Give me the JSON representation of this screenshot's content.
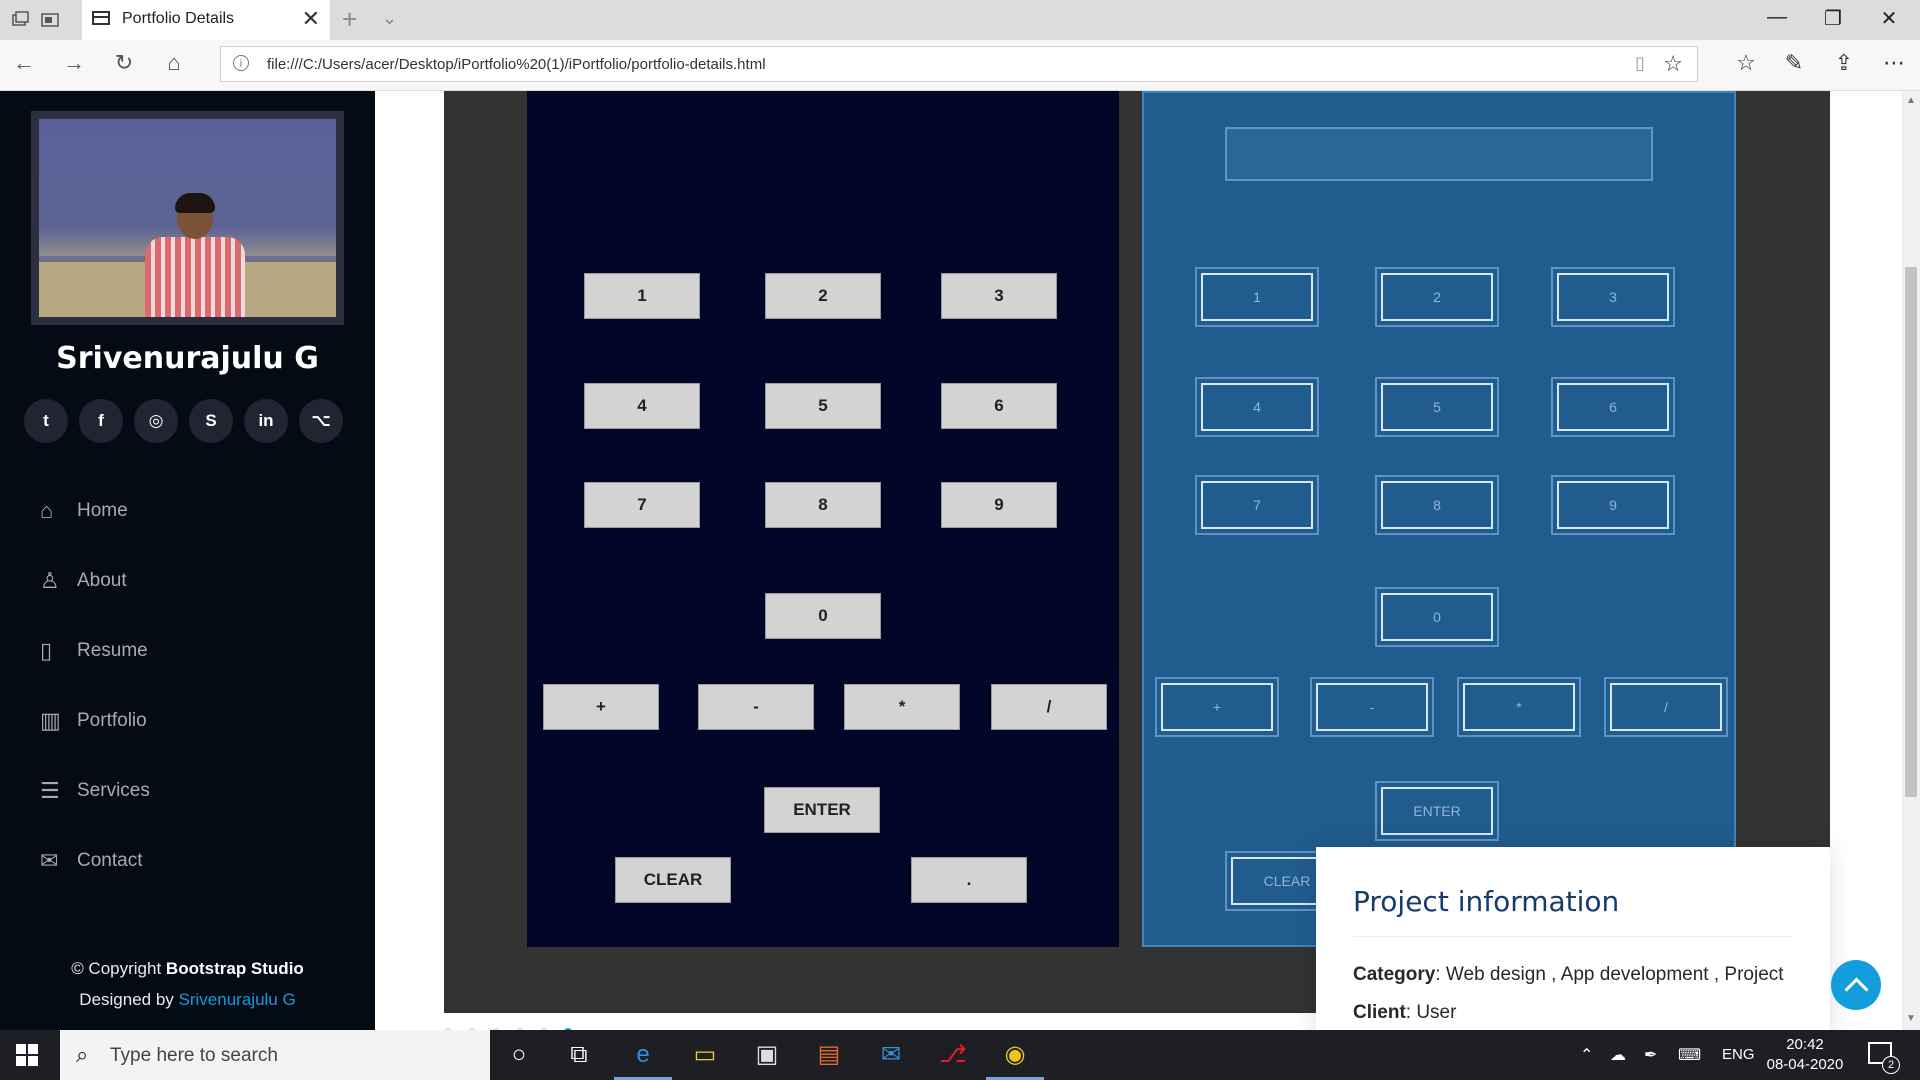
{
  "browser": {
    "tab_title": "Portfolio Details",
    "tab_close": "✕",
    "new_tab": "+",
    "url": "file:///C:/Users/acer/Desktop/iPortfolio%20(1)/iPortfolio/portfolio-details.html",
    "window_controls": [
      "—",
      "❐",
      "✕"
    ]
  },
  "sidebar": {
    "name": "Srivenurajulu G",
    "socials": [
      {
        "icon": "twitter-icon",
        "glyph": "t"
      },
      {
        "icon": "facebook-icon",
        "glyph": "f"
      },
      {
        "icon": "instagram-icon",
        "glyph": "◎"
      },
      {
        "icon": "skype-icon",
        "glyph": "S"
      },
      {
        "icon": "linkedin-icon",
        "glyph": "in"
      },
      {
        "icon": "github-icon",
        "glyph": "⌥"
      }
    ],
    "nav": [
      {
        "label": "Home",
        "icon": "home-icon",
        "glyph": "⌂"
      },
      {
        "label": "About",
        "icon": "user-icon",
        "glyph": "♙"
      },
      {
        "label": "Resume",
        "icon": "file-icon",
        "glyph": "▯"
      },
      {
        "label": "Portfolio",
        "icon": "book-icon",
        "glyph": "▥"
      },
      {
        "label": "Services",
        "icon": "server-icon",
        "glyph": "☰"
      },
      {
        "label": "Contact",
        "icon": "envelope-icon",
        "glyph": "✉"
      }
    ],
    "footer": {
      "copyright_prefix": "© Copyright ",
      "copyright_brand": "Bootstrap Studio",
      "designed_prefix": "Designed by ",
      "designer": "Srivenurajulu G"
    }
  },
  "calculator_dark": {
    "digits_row1": [
      "1",
      "2",
      "3"
    ],
    "digits_row2": [
      "4",
      "5",
      "6"
    ],
    "digits_row3": [
      "7",
      "8",
      "9"
    ],
    "zero": "0",
    "operators": [
      "+",
      "-",
      "*",
      "/"
    ],
    "enter": "ENTER",
    "clear": "CLEAR",
    "dot": "."
  },
  "calculator_blue": {
    "digits_row1": [
      "1",
      "2",
      "3"
    ],
    "digits_row2": [
      "4",
      "5",
      "6"
    ],
    "digits_row3": [
      "7",
      "8",
      "9"
    ],
    "zero": "0",
    "operators": [
      "+",
      "-",
      "*",
      "/"
    ],
    "enter": "ENTER",
    "clear": "CLEAR"
  },
  "project_info": {
    "title": "Project information",
    "category_label": "Category",
    "category_value": ": Web design , App development , Project",
    "client_label": "Client",
    "client_value": ": User"
  },
  "taskbar": {
    "search_placeholder": "Type here to search",
    "language": "ENG",
    "time": "20:42",
    "date": "08-04-2020",
    "notifications": "2"
  }
}
